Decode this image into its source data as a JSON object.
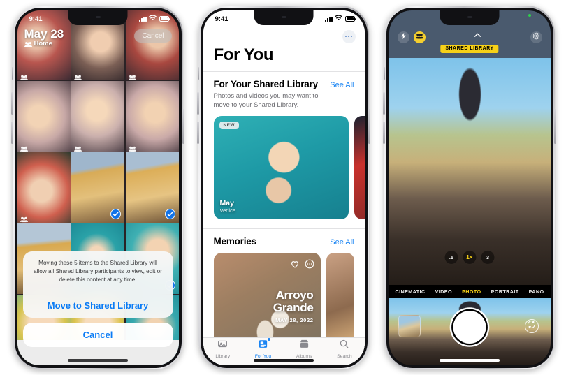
{
  "phones": {
    "picker": {
      "name": "photos-picker-phone",
      "status": {
        "time": "9:41"
      },
      "header": {
        "date": "May 28",
        "location": "Home",
        "cancel_label": "Cancel"
      },
      "grid": [
        {
          "id": 1,
          "tone": "pA",
          "selected": false,
          "shared": true
        },
        {
          "id": 2,
          "tone": "pB",
          "selected": false,
          "shared": true
        },
        {
          "id": 3,
          "tone": "pC",
          "selected": false,
          "shared": true
        },
        {
          "id": 4,
          "tone": "pD",
          "selected": false,
          "shared": true
        },
        {
          "id": 5,
          "tone": "pE",
          "selected": false,
          "shared": true
        },
        {
          "id": 6,
          "tone": "pF",
          "selected": false,
          "shared": true
        },
        {
          "id": 7,
          "tone": "pG",
          "selected": false,
          "shared": true
        },
        {
          "id": 8,
          "tone": "pH",
          "selected": true,
          "shared": false
        },
        {
          "id": 9,
          "tone": "pI",
          "selected": true,
          "shared": false
        },
        {
          "id": 10,
          "tone": "pJ",
          "selected": true,
          "shared": false
        },
        {
          "id": 11,
          "tone": "pK",
          "selected": true,
          "shared": false
        },
        {
          "id": 12,
          "tone": "pL",
          "selected": true,
          "shared": false
        },
        {
          "id": 13,
          "tone": "pM",
          "selected": false,
          "shared": false
        },
        {
          "id": 14,
          "tone": "pN",
          "selected": false,
          "shared": false
        },
        {
          "id": 15,
          "tone": "pO",
          "selected": false,
          "shared": false
        }
      ],
      "alert": {
        "message": "Moving these 5 items to the Shared Library will allow all Shared Library participants to view, edit or delete this content at any time.",
        "confirm_label": "Move to Shared Library",
        "cancel_label": "Cancel",
        "item_count": "5"
      }
    },
    "foryou": {
      "name": "for-you-phone",
      "status": {
        "time": "9:41"
      },
      "title": "For You",
      "shared_library": {
        "heading": "For Your Shared Library",
        "see_all": "See All",
        "subtitle": "Photos and videos you may want to move to your Shared Library.",
        "card": {
          "badge": "NEW",
          "title": "May",
          "subtitle": "Venice"
        }
      },
      "memories": {
        "heading": "Memories",
        "see_all": "See All",
        "card": {
          "title_line1": "Arroyo",
          "title_line2": "Grande",
          "date": "MAY 28, 2022"
        }
      },
      "tabs": [
        {
          "label": "Library",
          "icon": "library-icon",
          "active": false,
          "badge": false
        },
        {
          "label": "For You",
          "icon": "for-you-icon",
          "active": true,
          "badge": true
        },
        {
          "label": "Albums",
          "icon": "albums-icon",
          "active": false,
          "badge": false
        },
        {
          "label": "Search",
          "icon": "search-icon",
          "active": false,
          "badge": false
        }
      ]
    },
    "camera": {
      "name": "camera-phone",
      "top_controls": [
        {
          "name": "flash-icon",
          "style": "dark"
        },
        {
          "name": "shared-library-people-icon",
          "style": "yellow"
        }
      ],
      "shared_badge": "SHARED LIBRARY",
      "zoom_levels": [
        {
          "label": ".5",
          "active": false
        },
        {
          "label": "1×",
          "active": true
        },
        {
          "label": "3",
          "active": false
        }
      ],
      "modes": [
        {
          "label": "CINEMATIC",
          "active": false
        },
        {
          "label": "VIDEO",
          "active": false
        },
        {
          "label": "PHOTO",
          "active": true
        },
        {
          "label": "PORTRAIT",
          "active": false
        },
        {
          "label": "PANO",
          "active": false
        }
      ]
    }
  },
  "colors": {
    "accent_blue": "#1b85f3",
    "camera_yellow": "#f7d117",
    "check_blue": "#1273e8",
    "camera_top_bg": "#4a5a6e"
  }
}
